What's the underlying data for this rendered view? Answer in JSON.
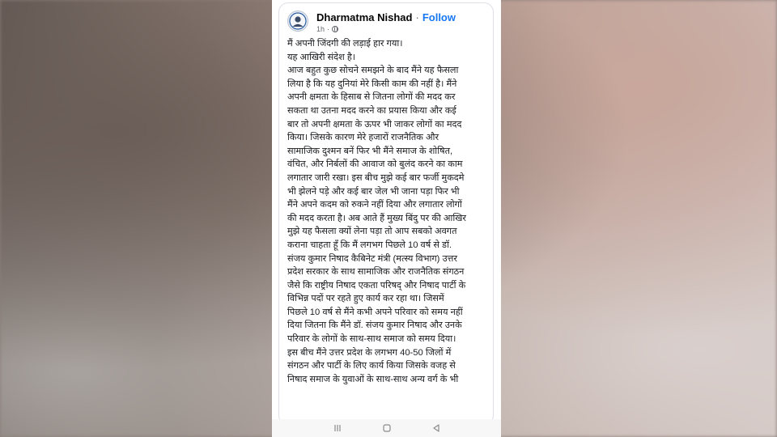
{
  "post": {
    "author": "Dharmatma Nishad",
    "follow_label": "Follow",
    "time": "1h",
    "lines": [
      "मैं अपनी जिंदगी की लड़ाई हार गया।",
      "यह आखिरी संदेश है।",
      "आज बहुत कुछ सोचने समझने के बाद मैंने यह फैसला",
      "लिया है कि यह दुनियां मेरे किसी काम की नहीं है। मैंने",
      "अपनी क्षमता के हिसाब से जितना लोगों की मदद कर",
      "सकता था उतना मदद करने का प्रयास किया और कई",
      "बार तो अपनी क्षमता के ऊपर भी जाकर लोगों का मदद",
      "किया। जिसके कारण मेरे हजारों राजनैतिक और",
      "सामाजिक दुश्मन बनें फिर भी मैंने समाज के शोषित,",
      "वंचित, और निर्बलों की आवाज को बुलंद करने का काम",
      "लगातार जारी रखा। इस बीच मुझे कई बार फर्जी मुकदमे",
      "भी झेलने पड़े और कई बार जेल भी जाना पड़ा फिर भी",
      "मैंने अपने कदम को रुकने नहीं दिया और लगातार लोगों",
      "की मदद करता है। अब आते हैं मुख्य बिंदु पर की आखिर",
      "मुझे यह फैसला क्यों लेना पड़ा तो आप सबको अवगत",
      "कराना चाहता हूँ कि मैं लगभग पिछले 10 वर्ष से डॉ.",
      "संजय कुमार निषाद कैबिनेट मंत्री (मत्स्य विभाग) उत्तर",
      "प्रदेश सरकार के साथ सामाजिक और राजनैतिक संगठन",
      "जैसे कि राष्ट्रीय निषाद एकता परिषद् और निषाद पार्टी के",
      "विभिन्न पदों पर रहते हुए कार्य कर रहा था। जिसमें",
      "पिछले 10 वर्ष से मैंने कभी अपने परिवार को समय नहीं",
      "दिया जितना कि मैंने डॉ. संजय कुमार निषाद और उनके",
      "परिवार के लोगों के साथ-साथ समाज को समय दिया।",
      "इस बीच मैंने उत्तर प्रदेश के लगभग 40-50 जिलों में",
      "संगठन और पार्टी के लिए कार्य किया जिसके वजह से",
      "निषाद समाज के युवाओं के साथ-साथ अन्य वर्ग के भी"
    ]
  },
  "icons": {
    "avatar": "avatar",
    "globe": "globe-icon",
    "nav": [
      "recent-apps-icon",
      "home-icon",
      "back-icon"
    ]
  },
  "colors": {
    "follow": "#1877f2",
    "text": "#1c1e21",
    "meta": "#65676b"
  }
}
